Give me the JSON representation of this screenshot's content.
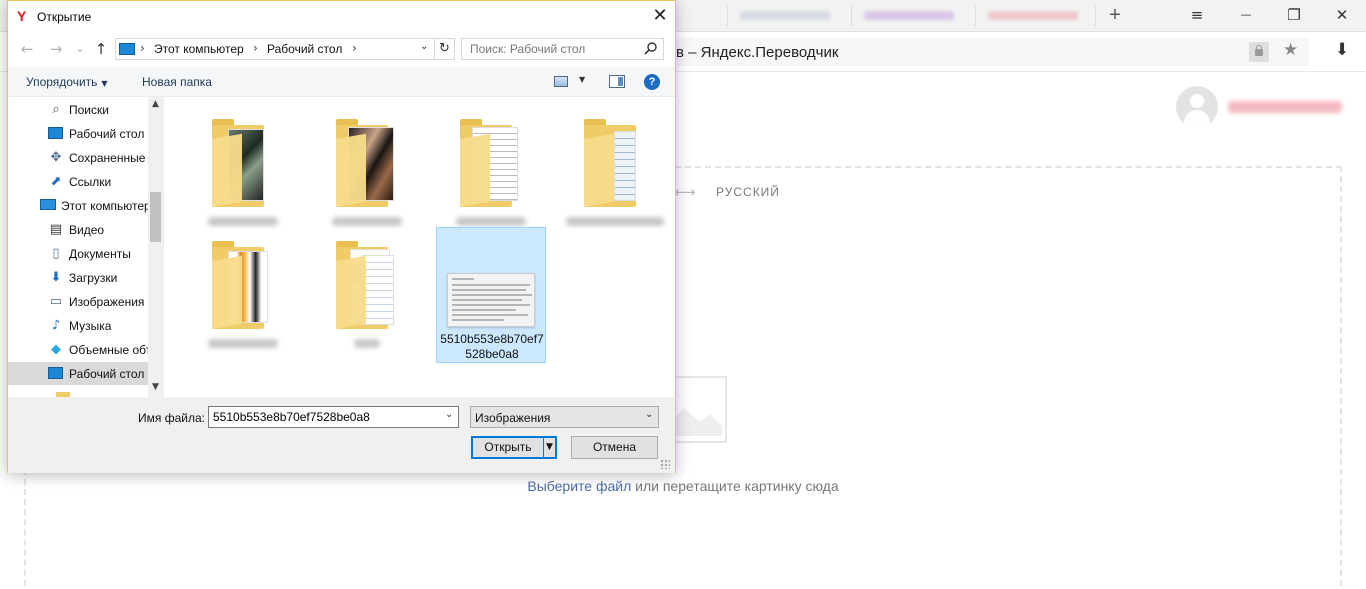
{
  "browser": {
    "page_title": "в – Яндекс.Переводчик",
    "new_tab": "+",
    "win_controls": {
      "menu": "≡",
      "minimize": "—",
      "restore": "❐",
      "close": "✕"
    },
    "star": "★",
    "download": "⬇",
    "accent_color": "#e21b1b"
  },
  "translator": {
    "arrow": "⟷",
    "target_language": "РУССКИЙ",
    "choose_file": "Выберите файл",
    "drop_hint": " или перетащите картинку сюда",
    "link_color": "#4b6ca8"
  },
  "dialog": {
    "logo": "Y",
    "title": "Открытие",
    "close": "✕",
    "nav": {
      "back": "←",
      "forward": "→",
      "recent": "⌄",
      "up": "↑"
    },
    "breadcrumb": [
      "Этот компьютер",
      "Рабочий стол"
    ],
    "breadcrumb_sep": "›",
    "refresh": "↻",
    "search_placeholder": "Поиск: Рабочий стол",
    "toolbar": {
      "organize": "Упорядочить",
      "new_folder": "Новая папка",
      "help": "?"
    },
    "nav_items": [
      {
        "label": "Поиски",
        "icon": "search-icon"
      },
      {
        "label": "Рабочий стол",
        "icon": "desktop-icon"
      },
      {
        "label": "Сохраненные",
        "icon": "saved-games-icon"
      },
      {
        "label": "Ссылки",
        "icon": "links-icon"
      },
      {
        "label": "Этот компьютер",
        "icon": "computer-icon"
      },
      {
        "label": "Видео",
        "icon": "video-icon"
      },
      {
        "label": "Документы",
        "icon": "documents-icon"
      },
      {
        "label": "Загрузки",
        "icon": "downloads-icon"
      },
      {
        "label": "Изображения",
        "icon": "pictures-icon"
      },
      {
        "label": "Музыка",
        "icon": "music-icon"
      },
      {
        "label": "Объемные объекты",
        "icon": "3d-objects-icon"
      },
      {
        "label": "Рабочий стол",
        "icon": "desktop-icon",
        "selected": true
      }
    ],
    "selected_file_label": "5510b553e8b70ef7528be0a8",
    "filename_label": "Имя файла:",
    "filename_value": "5510b553e8b70ef7528be0a8",
    "filetype": "Изображения",
    "open_button": "Открыть",
    "cancel_button": "Отмена",
    "border_color": "#e3c75c",
    "selection_color": "#cce8ff"
  }
}
